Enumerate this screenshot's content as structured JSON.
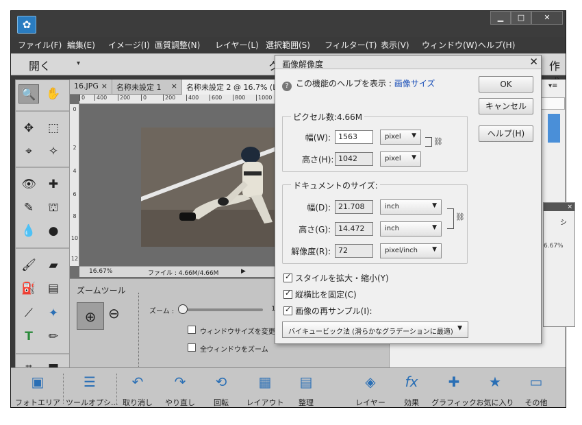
{
  "window": {
    "controls": {
      "minimize": "▁",
      "maximize": "□",
      "close": "✕"
    }
  },
  "menu": [
    "ファイル(F)",
    "編集(E)",
    "イメージ(I)",
    "画質調整(N)",
    "レイヤー(L)",
    "選択範囲(S)",
    "フィルター(T)",
    "表示(V)",
    "ウィンドウ(W)",
    "ヘルプ(H)"
  ],
  "topbar": {
    "open_label": "開く",
    "create_label": "作成",
    "partial_label": "ク"
  },
  "tabs": [
    {
      "label": "16.JPG",
      "close": "×"
    },
    {
      "label": "名称未設定 1",
      "close": "×"
    },
    {
      "label": "名称未設定 2 @ 16.7% (L"
    }
  ],
  "ruler": {
    "h": [
      "0",
      "400",
      "200",
      "0",
      "200",
      "400",
      "600",
      "800",
      "1000"
    ],
    "v": [
      "0",
      "2",
      "4",
      "6",
      "8",
      "10",
      "12"
    ]
  },
  "status": {
    "zoom": "16.67%",
    "file": "ファイル : 4.66M/4.66M",
    "arrow": "▶"
  },
  "tool_options": {
    "title": "ズームツール",
    "zoom_label": "ズーム :",
    "zoom_value": "1",
    "checkbox1": "ウィンドウサイズを変更",
    "checkbox2": "全ウィンドウをズーム"
  },
  "right_panel": {
    "menu_icon": "▾≡"
  },
  "float_panel": {
    "close": "×",
    "zoom": "6.67%",
    "partial": "シ"
  },
  "dock": [
    {
      "label": "フォトエリア",
      "icon": "photo-icon"
    },
    {
      "label": "ツールオプシ...",
      "icon": "tool-options-icon"
    },
    {
      "label": "取り消し",
      "icon": "undo-icon"
    },
    {
      "label": "やり直し",
      "icon": "redo-icon"
    },
    {
      "label": "回転",
      "icon": "rotate-icon"
    },
    {
      "label": "レイアウト",
      "icon": "layout-icon"
    },
    {
      "label": "整理",
      "icon": "organize-icon"
    },
    {
      "label": "レイヤー",
      "icon": "layers-icon"
    },
    {
      "label": "効果",
      "icon": "fx-icon"
    },
    {
      "label": "グラフィック",
      "icon": "plus-icon"
    },
    {
      "label": "お気に入り",
      "icon": "star-icon"
    },
    {
      "label": "その他",
      "icon": "more-icon"
    }
  ],
  "dialog": {
    "title": "画像解像度",
    "close": "✕",
    "help_text": "この機能のヘルプを表示 : ",
    "help_link": "画像サイズ",
    "buttons": {
      "ok": "OK",
      "cancel": "キャンセル",
      "help": "ヘルプ(H)"
    },
    "pixel_group": {
      "title": "ピクセル数:4.66M",
      "width_label": "幅(W):",
      "width_value": "1563",
      "width_unit": "pixel",
      "height_label": "高さ(H):",
      "height_value": "1042",
      "height_unit": "pixel"
    },
    "doc_group": {
      "title": "ドキュメントのサイズ:",
      "width_label": "幅(D):",
      "width_value": "21.708",
      "width_unit": "inch",
      "height_label": "高さ(G):",
      "height_value": "14.472",
      "height_unit": "inch",
      "res_label": "解像度(R):",
      "res_value": "72",
      "res_unit": "pixel/inch"
    },
    "checkboxes": [
      {
        "label": "スタイルを拡大・縮小(Y)",
        "checked": true
      },
      {
        "label": "縦横比を固定(C)",
        "checked": true
      },
      {
        "label": "画像の再サンプル(I):",
        "checked": true
      }
    ],
    "resample_method": "バイキュービック法 (滑らかなグラデーションに最適)"
  },
  "colors": {
    "accent": "#2a6fb5",
    "panel": "#c6c6c6",
    "dialog": "#f0f0f0",
    "link": "#1a4fb8"
  }
}
